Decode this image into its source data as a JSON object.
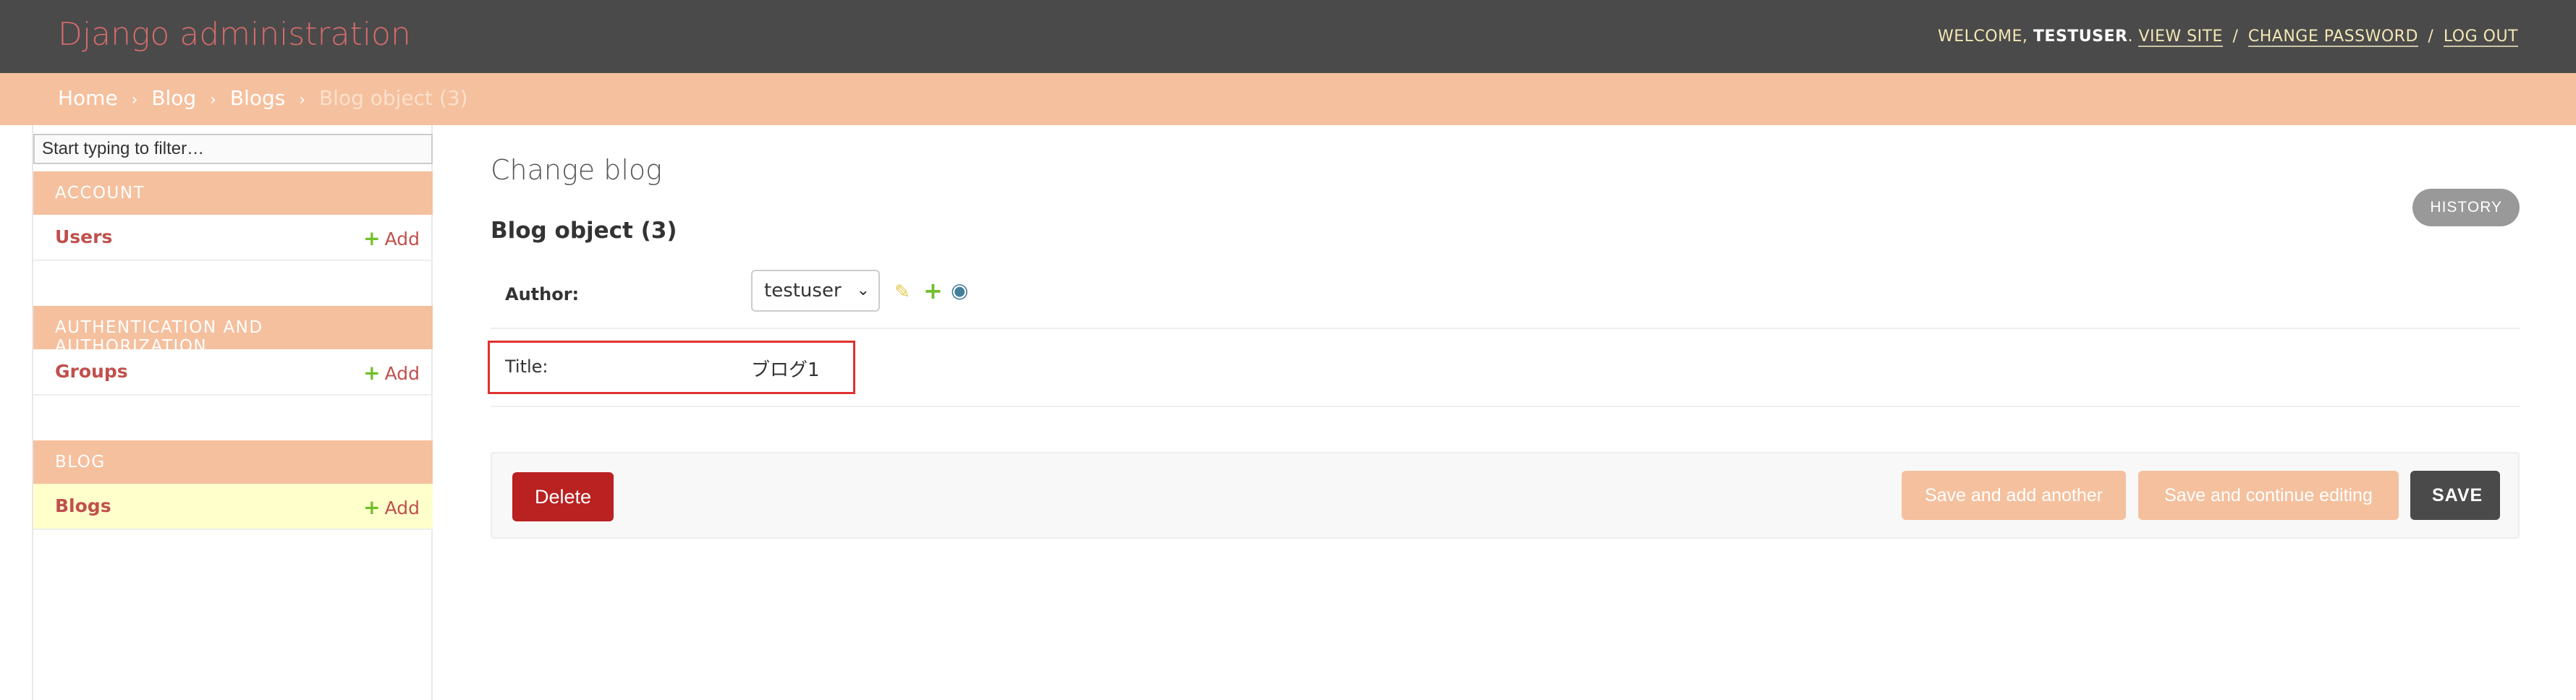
{
  "header": {
    "brand": "Django administration",
    "welcome": "WELCOME,",
    "username": "TESTUSER",
    "view_site": "VIEW SITE",
    "change_password": "CHANGE PASSWORD",
    "log_out": "LOG OUT",
    "separator": "/",
    "username_suffix": "."
  },
  "breadcrumbs": {
    "items": [
      "Home",
      "Blog",
      "Blogs"
    ],
    "current": "Blog object (3)",
    "arrow": "›"
  },
  "sidebar": {
    "filter_placeholder": "Start typing to filter…",
    "add_label": "Add",
    "modules": [
      {
        "caption": "Account",
        "models": [
          {
            "name": "Users",
            "selected": false
          }
        ]
      },
      {
        "caption": "Authentication and Authorization",
        "models": [
          {
            "name": "Groups",
            "selected": false
          }
        ]
      },
      {
        "caption": "Blog",
        "models": [
          {
            "name": "Blogs",
            "selected": true
          }
        ]
      }
    ]
  },
  "content": {
    "page_title": "Change blog",
    "history_label": "HISTORY",
    "object_title": "Blog object (3)",
    "fields": {
      "author": {
        "label": "Author:",
        "value": "testuser"
      },
      "title": {
        "label": "Title:",
        "value": "ブログ1"
      }
    },
    "buttons": {
      "delete": "Delete",
      "save_add_another": "Save and add another",
      "save_continue": "Save and continue editing",
      "save": "SAVE"
    }
  },
  "colors": {
    "header_bg": "#4a4a4a",
    "brand": "#d66b6b",
    "accent": "#f5c09e",
    "link": "#c0504d",
    "delete": "#ba2121",
    "highlight": "#e03131"
  },
  "icons": {
    "edit": "pencil-icon",
    "add": "plus-icon",
    "view": "eye-icon",
    "select": "chevron-down-icon"
  }
}
